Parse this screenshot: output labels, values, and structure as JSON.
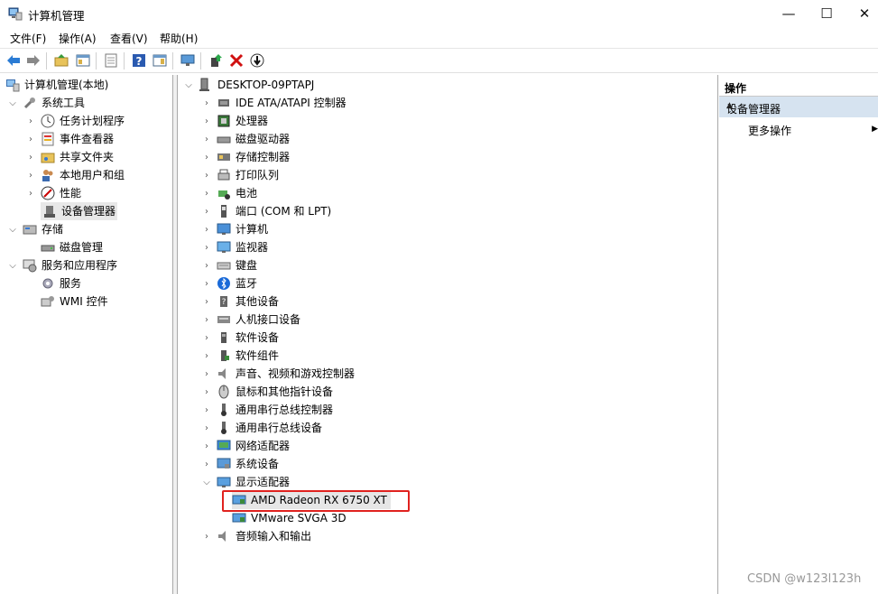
{
  "window": {
    "title": "计算机管理",
    "minimize": "—",
    "maximize": "☐",
    "close": "✕"
  },
  "menu": [
    "文件(F)",
    "操作(A)",
    "查看(V)",
    "帮助(H)"
  ],
  "left_tree": {
    "root": "计算机管理(本地)",
    "system_tools": "系统工具",
    "task_scheduler": "任务计划程序",
    "event_viewer": "事件查看器",
    "shared_folders": "共享文件夹",
    "local_users": "本地用户和组",
    "performance": "性能",
    "device_manager": "设备管理器",
    "storage": "存储",
    "disk_management": "磁盘管理",
    "services_apps": "服务和应用程序",
    "services": "服务",
    "wmi": "WMI 控件"
  },
  "device_tree": {
    "computer": "DESKTOP-09PTAPJ",
    "categories": [
      "IDE ATA/ATAPI 控制器",
      "处理器",
      "磁盘驱动器",
      "存储控制器",
      "打印队列",
      "电池",
      "端口 (COM 和 LPT)",
      "计算机",
      "监视器",
      "键盘",
      "蓝牙",
      "其他设备",
      "人机接口设备",
      "软件设备",
      "软件组件",
      "声音、视频和游戏控制器",
      "鼠标和其他指针设备",
      "通用串行总线控制器",
      "通用串行总线设备",
      "网络适配器",
      "系统设备",
      "显示适配器"
    ],
    "display_adapters": [
      "AMD Radeon RX 6750 XT",
      "VMware SVGA 3D"
    ],
    "audio_io": "音频输入和输出"
  },
  "actions": {
    "header": "操作",
    "group": "设备管理器",
    "more": "更多操作"
  },
  "watermark": "CSDN @w123l123h",
  "colors": {
    "selection_highlight": "#e0221f",
    "action_group_bg": "#d6e3f0"
  }
}
